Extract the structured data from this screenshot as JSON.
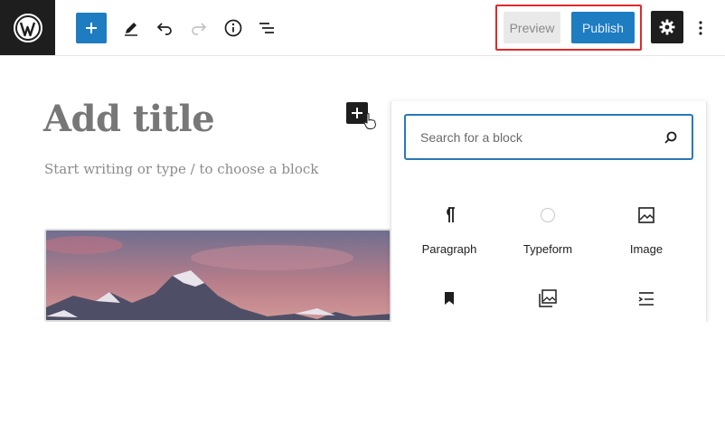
{
  "toolbar": {
    "logo_icon": "wordpress-logo",
    "add_block_label": "+",
    "tools": [
      "pencil-icon",
      "undo-icon",
      "redo-icon",
      "info-icon",
      "list-view-icon"
    ],
    "preview_label": "Preview",
    "publish_label": "Publish",
    "settings_icon": "gear-icon",
    "more_icon": "more-vertical-icon",
    "accent_color": "#1e7cc1",
    "highlight_color": "#e02a2a"
  },
  "editor": {
    "title_placeholder": "Add title",
    "body_placeholder": "Start writing or type / to choose a block",
    "image_block_icon": "mountain-image"
  },
  "inserter": {
    "search_placeholder": "Search for a block",
    "blocks": [
      {
        "label": "Paragraph",
        "icon": "pilcrow-icon"
      },
      {
        "label": "Typeform",
        "icon": "typeform-icon"
      },
      {
        "label": "Image",
        "icon": "image-icon"
      },
      {
        "label": "",
        "icon": "bookmark-icon"
      },
      {
        "label": "",
        "icon": "gallery-icon"
      },
      {
        "label": "",
        "icon": "list-icon"
      }
    ]
  }
}
